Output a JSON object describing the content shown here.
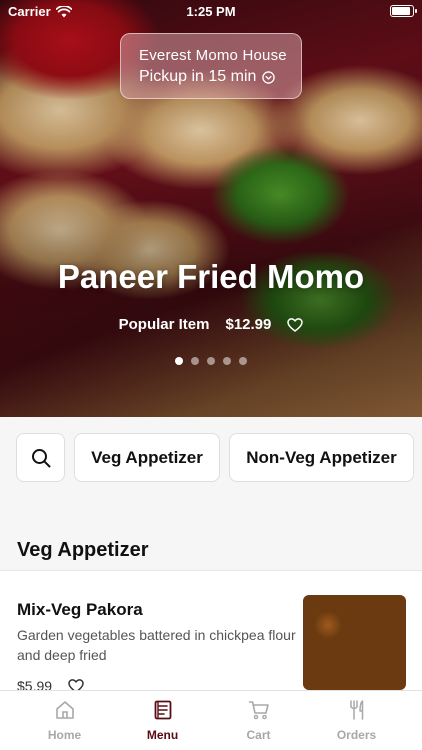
{
  "status_bar": {
    "carrier": "Carrier",
    "time": "1:25 PM"
  },
  "header": {
    "store_name": "Everest Momo House",
    "pickup_text": "Pickup in 15 min"
  },
  "hero": {
    "title": "Paneer Fried Momo",
    "tag": "Popular Item",
    "price": "$12.99",
    "slides_total": 5,
    "slide_active": 1
  },
  "categories": {
    "search_icon": "search-icon",
    "chips": [
      "Veg Appetizer",
      "Non-Veg Appetizer"
    ]
  },
  "section": {
    "title": "Veg Appetizer"
  },
  "items": [
    {
      "name": "Mix-Veg Pakora",
      "description": "Garden vegetables battered in chickpea flour and deep fried",
      "price": "$5.99"
    }
  ],
  "tabbar": {
    "tabs": [
      {
        "label": "Home",
        "icon": "home-icon"
      },
      {
        "label": "Menu",
        "icon": "menu-icon"
      },
      {
        "label": "Cart",
        "icon": "cart-icon"
      },
      {
        "label": "Orders",
        "icon": "fork-knife-icon"
      }
    ],
    "active": "Menu"
  },
  "colors": {
    "accent": "#5a0c14",
    "inactive": "#a8a8a8",
    "background": "#f6f6f6"
  }
}
